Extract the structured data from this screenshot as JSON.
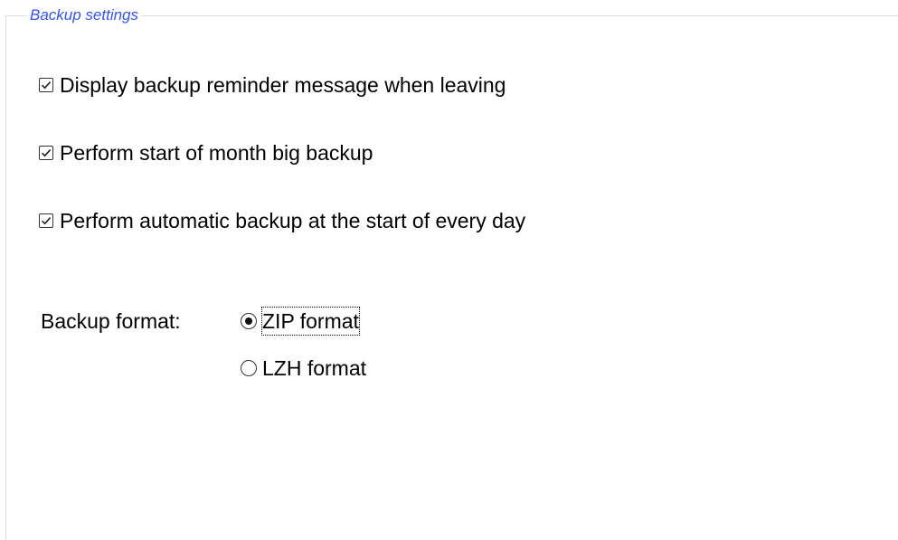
{
  "group": {
    "title": "Backup settings",
    "title_color": "#3355ee"
  },
  "checkboxes": [
    {
      "label": "Display backup reminder message when leaving",
      "checked": true
    },
    {
      "label": "Perform start of month big backup",
      "checked": true
    },
    {
      "label": "Perform automatic backup at the start of every day",
      "checked": true
    }
  ],
  "backup_format": {
    "label": "Backup format:",
    "options": [
      {
        "label": "ZIP format",
        "selected": true,
        "focused": true
      },
      {
        "label": "LZH format",
        "selected": false,
        "focused": false
      }
    ]
  },
  "icons": {
    "checkbox": "checkbox-checked-icon",
    "radio_selected": "radio-selected-icon",
    "radio_unselected": "radio-unselected-icon"
  }
}
